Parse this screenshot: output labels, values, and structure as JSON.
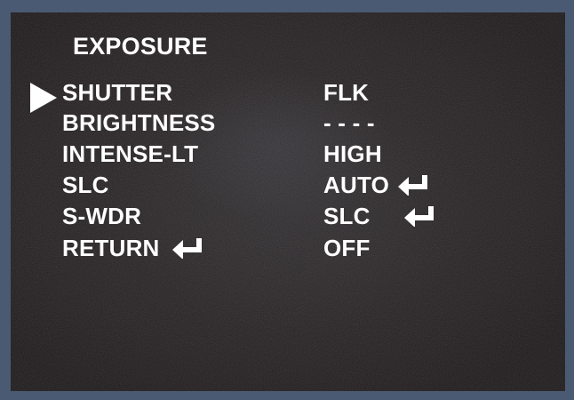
{
  "menu": {
    "title": "EXPOSURE",
    "cursor_icon": "triangle-right-icon",
    "enter_icon": "return-arrow-icon",
    "items": [
      {
        "label": "SHUTTER",
        "value": "FLK"
      },
      {
        "label": "BRIGHTNESS",
        "value": "- - - -"
      },
      {
        "label": "INTENSE-LT",
        "value": "HIGH"
      },
      {
        "label": "SLC",
        "value": "AUTO"
      },
      {
        "label": "S-WDR",
        "value": "SLC"
      },
      {
        "label": "RETURN",
        "value": "OFF"
      }
    ],
    "selected_index": 0
  },
  "colors": {
    "frame": "#4b5a73",
    "screen": "#262223",
    "text": "#ffffff"
  }
}
